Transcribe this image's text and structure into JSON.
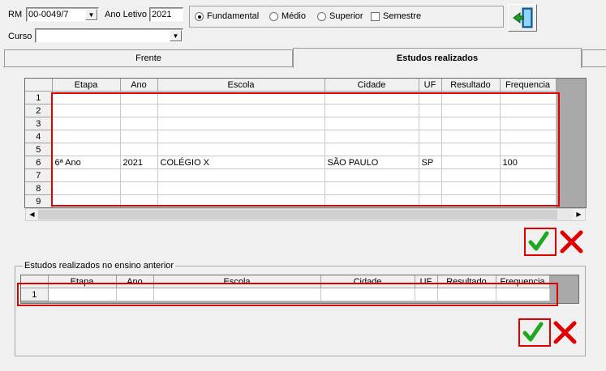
{
  "header": {
    "rm_label": "RM",
    "rm_value": "00-0049/7",
    "ano_label": "Ano Letivo",
    "ano_value": "2021",
    "curso_label": "Curso",
    "curso_value": ""
  },
  "levels": {
    "fundamental": "Fundamental",
    "medio": "Médio",
    "superior": "Superior",
    "semestre": "Semestre",
    "selected": "fundamental"
  },
  "tabs": [
    {
      "label": "Frente",
      "active": false
    },
    {
      "label": "Estudos realizados",
      "active": true
    }
  ],
  "estudos_grid": {
    "columns": [
      "Etapa",
      "Ano",
      "Escola",
      "Cidade",
      "UF",
      "Resultado",
      "Frequencia"
    ],
    "rows": [
      {
        "n": "1",
        "cells": [
          "",
          "",
          "",
          "",
          "",
          "",
          ""
        ]
      },
      {
        "n": "2",
        "cells": [
          "",
          "",
          "",
          "",
          "",
          "",
          ""
        ]
      },
      {
        "n": "3",
        "cells": [
          "",
          "",
          "",
          "",
          "",
          "",
          ""
        ]
      },
      {
        "n": "4",
        "cells": [
          "",
          "",
          "",
          "",
          "",
          "",
          ""
        ]
      },
      {
        "n": "5",
        "cells": [
          "",
          "",
          "",
          "",
          "",
          "",
          ""
        ]
      },
      {
        "n": "6",
        "cells": [
          "6ª Ano",
          "2021",
          "COLÉGIO X",
          "SÃO PAULO",
          "SP",
          "",
          "100"
        ]
      },
      {
        "n": "7",
        "cells": [
          "",
          "",
          "",
          "",
          "",
          "",
          ""
        ]
      },
      {
        "n": "8",
        "cells": [
          "",
          "",
          "",
          "",
          "",
          "",
          ""
        ]
      },
      {
        "n": "9",
        "cells": [
          "",
          "",
          "",
          "",
          "",
          "",
          ""
        ]
      }
    ]
  },
  "anterior": {
    "title": "Estudos realizados no ensino anterior",
    "columns": [
      "Etapa",
      "Ano",
      "Escola",
      "Cidade",
      "UF",
      "Resultado",
      "Frequencia"
    ],
    "rows": [
      {
        "n": "1",
        "cells": [
          "",
          "",
          "",
          "",
          "",
          "",
          ""
        ]
      }
    ]
  },
  "icons": {
    "exit": "exit-door-icon",
    "confirm": "green-check-icon",
    "cancel": "red-x-icon"
  },
  "colors": {
    "highlight": "#e00000",
    "check": "#1fa81f",
    "cancel": "#e00000"
  }
}
